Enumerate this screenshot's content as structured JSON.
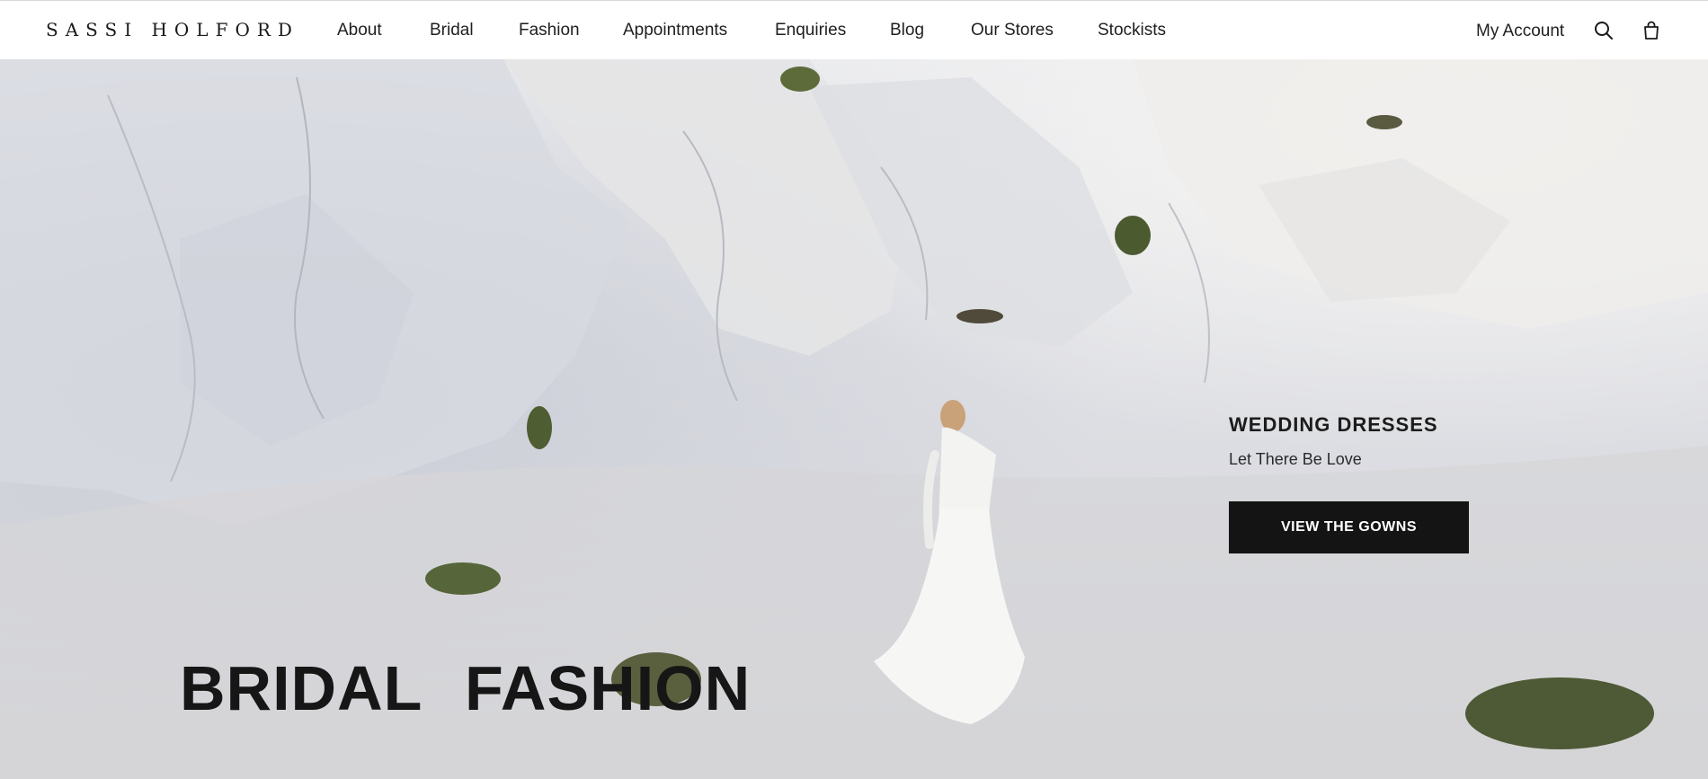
{
  "brand": {
    "logo_text": "SASSI HOLFORD"
  },
  "nav": {
    "items": [
      {
        "label": "About"
      },
      {
        "label": "Bridal"
      },
      {
        "label": "Fashion"
      },
      {
        "label": "Appointments"
      },
      {
        "label": "Enquiries"
      },
      {
        "label": "Blog"
      },
      {
        "label": "Our Stores"
      },
      {
        "label": "Stockists"
      }
    ]
  },
  "account": {
    "label": "My Account"
  },
  "icons": {
    "search": "search-icon",
    "cart": "shopping-bag-icon"
  },
  "hero": {
    "promo_title": "WEDDING DRESSES",
    "promo_subtitle": "Let There Be Love",
    "promo_button": "VIEW THE GOWNS",
    "tab_bridal": "BRIDAL",
    "tab_fashion": "FASHION"
  },
  "colors": {
    "button_bg": "#141414",
    "text_dark": "#1a1a1a",
    "header_bg": "#ffffff"
  }
}
